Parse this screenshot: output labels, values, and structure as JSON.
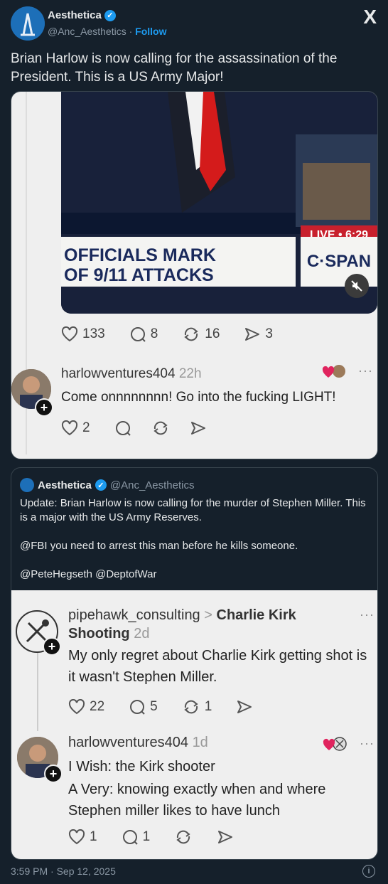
{
  "author": {
    "name": "Aesthetica",
    "handle": "@Anc_Aesthetics",
    "separator": "·",
    "follow_label": "Follow"
  },
  "tweet": {
    "text": "Brian Harlow is now calling for the assassination of the President. This is a US Army Major!"
  },
  "screenshot1": {
    "caption_line1": "OFFICIALS MARK",
    "caption_line2": "OF 9/11 ATTACKS",
    "network": "C·SPAN",
    "live_label": "LIVE",
    "live_time": "6:29",
    "stats": {
      "likes": "133",
      "replies": "8",
      "reposts": "16",
      "shares": "3"
    },
    "reply": {
      "username": "harlowventures404",
      "time": "22h",
      "text": "Come onnnnnnnn! Go into the fucking LIGHT!",
      "likes": "2"
    }
  },
  "quote": {
    "name": "Aesthetica",
    "handle": "@Anc_Aesthetics",
    "text1": "Update: Brian Harlow is now calling for the murder of Stephen Miller. This is a major with the US Army Reserves.",
    "text2": "@FBI you need to arrest this man before he kills someone.",
    "text3": "@PeteHegseth @DeptofWar"
  },
  "screenshot2": {
    "post1": {
      "username": "pipehawk_consulting",
      "topic": "Charlie Kirk",
      "topic_line2": "Shooting",
      "time": "2d",
      "text": "My only regret about Charlie Kirk getting shot is it wasn't Stephen Miller.",
      "likes": "22",
      "replies": "5",
      "reposts": "1"
    },
    "post2": {
      "username": "harlowventures404",
      "time": "1d",
      "line1": "I Wish: the Kirk shooter",
      "line2": "A Very: knowing exactly when and where",
      "line3": "Stephen miller likes to have lunch",
      "likes": "1",
      "replies": "1"
    }
  },
  "timestamp": "3:59 PM · Sep 12, 2025",
  "info_glyph": "i",
  "x_logo": "X",
  "more_glyph": "···",
  "topic_chevron": ">"
}
